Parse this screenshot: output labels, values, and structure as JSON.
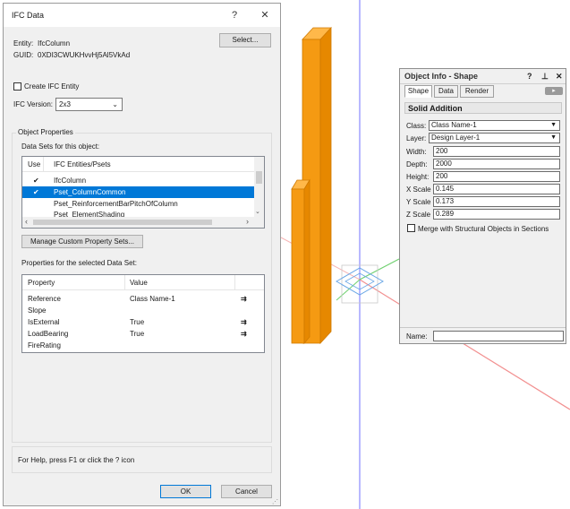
{
  "ifc_dialog": {
    "title": "IFC Data",
    "help_button": "?",
    "close_button": "✕",
    "entity_label": "Entity:",
    "entity_value": "IfcColumn",
    "guid_label": "GUID:",
    "guid_value": "0XDI3CWUKHvvHj5Al5VkAd",
    "select_button": "Select...",
    "create_ifc_entity_label": "Create IFC Entity",
    "create_ifc_entity_checked": false,
    "ifc_version_label": "IFC Version:",
    "ifc_version_value": "2x3",
    "object_properties_label": "Object Properties",
    "data_sets_label": "Data Sets for this object:",
    "psets_header_use": "Use",
    "psets_header_entities": "IFC Entities/Psets",
    "psets": [
      {
        "use": "✔",
        "name": "IfcColumn",
        "selected": false
      },
      {
        "use": "✔",
        "name": "Pset_ColumnCommon",
        "selected": true
      },
      {
        "use": "",
        "name": "Pset_ReinforcementBarPitchOfColumn",
        "selected": false
      },
      {
        "use": "",
        "name": "Pset_ElementShading",
        "selected": false
      }
    ],
    "manage_button": "Manage Custom Property Sets...",
    "properties_label": "Properties for the selected Data Set:",
    "props_header_property": "Property",
    "props_header_value": "Value",
    "properties": [
      {
        "property": "Reference",
        "value": "Class Name-1",
        "link": "⇉"
      },
      {
        "property": "Slope",
        "value": "",
        "link": ""
      },
      {
        "property": "IsExternal",
        "value": "True",
        "link": "⇉"
      },
      {
        "property": "LoadBearing",
        "value": "True",
        "link": "⇉"
      },
      {
        "property": "FireRating",
        "value": "",
        "link": ""
      }
    ],
    "status_text": "For Help, press F1 or click the ? icon",
    "ok_button": "OK",
    "cancel_button": "Cancel"
  },
  "object_info": {
    "title": "Object Info - Shape",
    "help_button": "?",
    "pin_button": "⊥",
    "close_button": "✕",
    "tabs": [
      "Shape",
      "Data",
      "Render"
    ],
    "active_tab": "Shape",
    "object_type": "Solid Addition",
    "class_label": "Class:",
    "class_value": "Class Name-1",
    "layer_label": "Layer:",
    "layer_value": "Design Layer-1",
    "width_label": "Width:",
    "width_value": "200",
    "depth_label": "Depth:",
    "depth_value": "2000",
    "height_label": "Height:",
    "height_value": "200",
    "xscale_label": "X Scale",
    "xscale_value": "0.145",
    "yscale_label": "Y Scale",
    "yscale_value": "0.173",
    "zscale_label": "Z Scale",
    "zscale_value": "0.289",
    "merge_label": "Merge with Structural Objects in Sections",
    "merge_checked": false,
    "name_label": "Name:",
    "name_value": ""
  },
  "colors": {
    "column_orange": "#f59a12",
    "selection_blue": "#0078d7",
    "axis_blue": "#8080ff",
    "axis_red": "#f08080",
    "axis_green": "#6ccf6c"
  }
}
